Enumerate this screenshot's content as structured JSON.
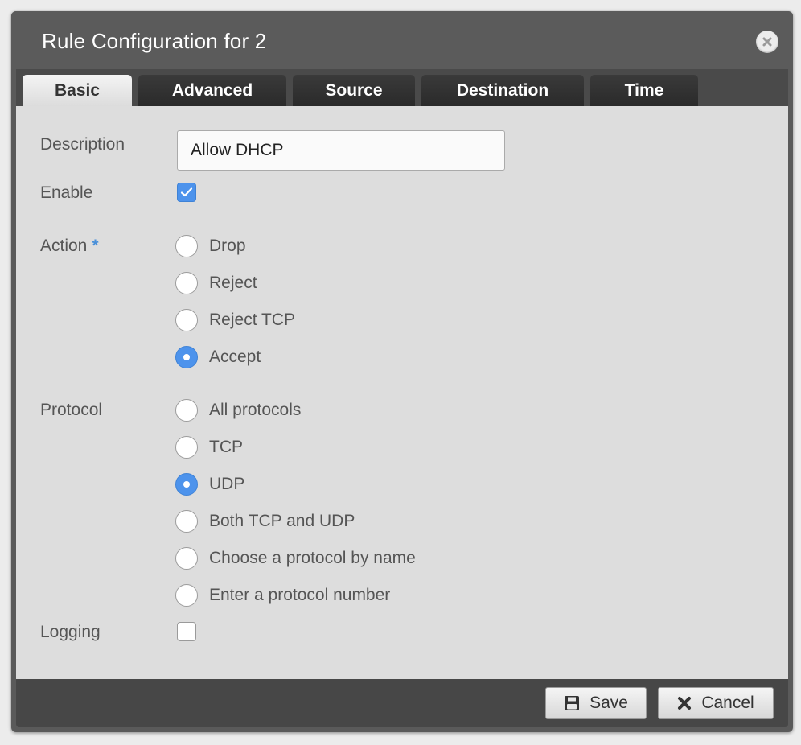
{
  "dialog": {
    "title": "Rule Configuration for 2",
    "close_icon": "close-icon"
  },
  "tabs": [
    {
      "label": "Basic",
      "active": true
    },
    {
      "label": "Advanced",
      "active": false
    },
    {
      "label": "Source",
      "active": false
    },
    {
      "label": "Destination",
      "active": false
    },
    {
      "label": "Time",
      "active": false
    }
  ],
  "form": {
    "description": {
      "label": "Description",
      "value": "Allow DHCP"
    },
    "enable": {
      "label": "Enable",
      "checked": true
    },
    "action": {
      "label": "Action",
      "required_mark": "*",
      "options": [
        {
          "label": "Drop",
          "selected": false
        },
        {
          "label": "Reject",
          "selected": false
        },
        {
          "label": "Reject TCP",
          "selected": false
        },
        {
          "label": "Accept",
          "selected": true
        }
      ]
    },
    "protocol": {
      "label": "Protocol",
      "options": [
        {
          "label": "All protocols",
          "selected": false
        },
        {
          "label": "TCP",
          "selected": false
        },
        {
          "label": "UDP",
          "selected": true
        },
        {
          "label": "Both TCP and UDP",
          "selected": false
        },
        {
          "label": "Choose a protocol by name",
          "selected": false
        },
        {
          "label": "Enter a protocol number",
          "selected": false
        }
      ]
    },
    "logging": {
      "label": "Logging",
      "checked": false
    }
  },
  "footer": {
    "save_label": "Save",
    "save_icon": "floppy-disk-icon",
    "cancel_label": "Cancel",
    "cancel_icon": "x-icon"
  },
  "colors": {
    "accent": "#4d93ec",
    "titlebar": "#5b5b5b",
    "content_bg": "#dddddd"
  }
}
